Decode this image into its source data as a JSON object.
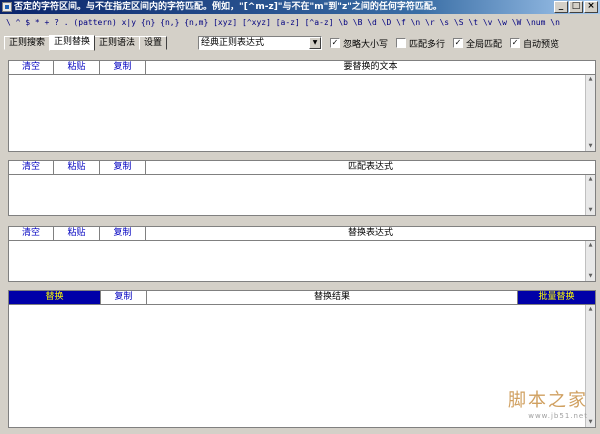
{
  "window": {
    "title": "否定的字符区间。与不在指定区间内的字符匹配。例如，\"[^m-z]\"与不在\"m\"到\"z\"之间的任何字符匹配。",
    "minimize": "_",
    "maximize": "□",
    "close": "×"
  },
  "syntax_bar": "\\ ^ $ * + ? . (pattern) x|y {n} {n,} {n,m} [xyz] [^xyz] [a-z] [^a-z] \\b \\B \\d \\D \\f \\n \\r \\s \\S \\t \\v \\w \\W \\num \\n",
  "tabs": [
    "正则搜索",
    "正则替换",
    "正则语法",
    "设置"
  ],
  "active_tab": "正则替换",
  "mode_select": {
    "value": "经典正则表达式"
  },
  "options": [
    {
      "label": "忽略大小写",
      "checked": true
    },
    {
      "label": "匹配多行",
      "checked": false
    },
    {
      "label": "全局匹配",
      "checked": true
    },
    {
      "label": "自动预览",
      "checked": true
    }
  ],
  "source_panel": {
    "clear": "清空",
    "paste": "粘贴",
    "copy": "复制",
    "label": "要替换的文本"
  },
  "pattern_panel": {
    "clear": "清空",
    "paste": "粘贴",
    "copy": "复制",
    "label": "匹配表达式"
  },
  "replace_panel": {
    "clear": "清空",
    "paste": "粘贴",
    "copy": "复制",
    "label": "替换表达式"
  },
  "result_panel": {
    "replace": "替换",
    "copy": "复制",
    "label": "替换结果",
    "batch": "批量替换"
  },
  "watermark": {
    "text": "脚本之家",
    "url": "www.jb51.net"
  },
  "colors": {
    "title_start": "#0a246a",
    "accent_blue": "#0000c0",
    "highlight_bg": "#0000a8",
    "highlight_fg": "#ffff00"
  }
}
